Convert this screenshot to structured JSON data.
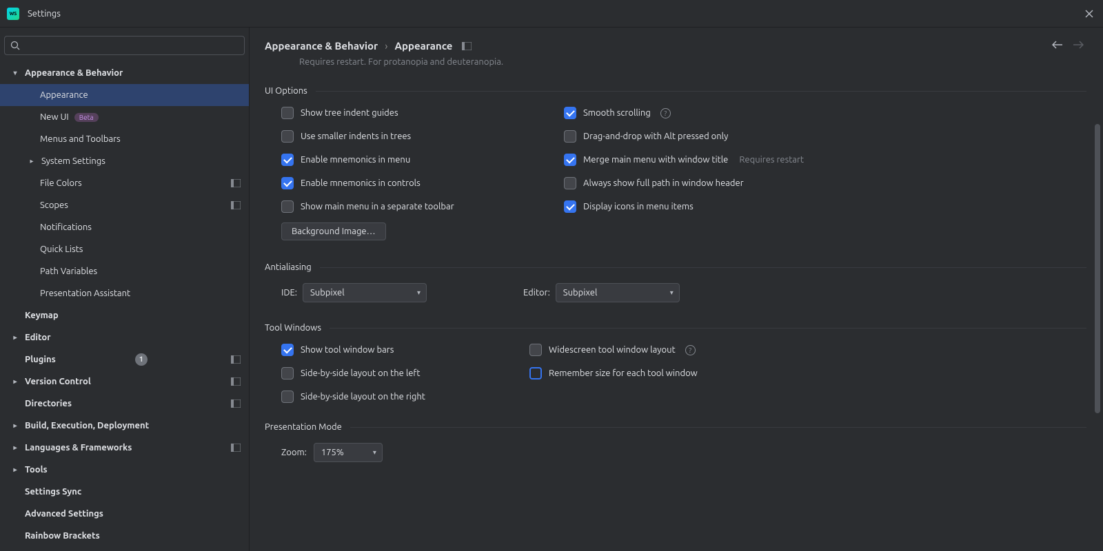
{
  "window": {
    "title": "Settings",
    "app_icon_text": "WS"
  },
  "search": {
    "placeholder": ""
  },
  "sidebar": {
    "items": [
      {
        "label": "Appearance & Behavior",
        "level": 1,
        "chevron": "down"
      },
      {
        "label": "Appearance",
        "level": 2,
        "selected": true
      },
      {
        "label": "New UI",
        "level": 2,
        "badge": "Beta"
      },
      {
        "label": "Menus and Toolbars",
        "level": 2
      },
      {
        "label": "System Settings",
        "level": 2,
        "chevron": "right",
        "chevron_indent": true
      },
      {
        "label": "File Colors",
        "level": 2,
        "project_icon": true
      },
      {
        "label": "Scopes",
        "level": 2,
        "project_icon": true
      },
      {
        "label": "Notifications",
        "level": 2
      },
      {
        "label": "Quick Lists",
        "level": 2
      },
      {
        "label": "Path Variables",
        "level": 2
      },
      {
        "label": "Presentation Assistant",
        "level": 2
      },
      {
        "label": "Keymap",
        "level": 1,
        "chevron": "none"
      },
      {
        "label": "Editor",
        "level": 1,
        "chevron": "right"
      },
      {
        "label": "Plugins",
        "level": 1,
        "chevron": "none",
        "count": "1",
        "project_icon": true
      },
      {
        "label": "Version Control",
        "level": 1,
        "chevron": "right",
        "project_icon": true
      },
      {
        "label": "Directories",
        "level": 1,
        "chevron": "none",
        "project_icon": true
      },
      {
        "label": "Build, Execution, Deployment",
        "level": 1,
        "chevron": "right"
      },
      {
        "label": "Languages & Frameworks",
        "level": 1,
        "chevron": "right",
        "project_icon": true
      },
      {
        "label": "Tools",
        "level": 1,
        "chevron": "right"
      },
      {
        "label": "Settings Sync",
        "level": 1,
        "chevron": "none"
      },
      {
        "label": "Advanced Settings",
        "level": 1,
        "chevron": "none"
      },
      {
        "label": "Rainbow Brackets",
        "level": 1,
        "chevron": "none"
      }
    ]
  },
  "breadcrumb": {
    "root": "Appearance & Behavior",
    "sep": "›",
    "leaf": "Appearance"
  },
  "hint": "Requires restart. For protanopia and deuteranopia.",
  "sections": {
    "ui_options": {
      "title": "UI Options",
      "left": [
        {
          "label": "Show tree indent guides",
          "checked": false
        },
        {
          "label": "Use smaller indents in trees",
          "checked": false
        },
        {
          "label": "Enable mnemonics in menu",
          "checked": true
        },
        {
          "label": "Enable mnemonics in controls",
          "checked": true
        },
        {
          "label": "Show main menu in a separate toolbar",
          "checked": false
        }
      ],
      "right": [
        {
          "label": "Smooth scrolling",
          "checked": true,
          "help": true
        },
        {
          "label": "Drag-and-drop with Alt pressed only",
          "checked": false
        },
        {
          "label": "Merge main menu with window title",
          "checked": true,
          "suffix": "Requires restart"
        },
        {
          "label": "Always show full path in window header",
          "checked": false
        },
        {
          "label": "Display icons in menu items",
          "checked": true
        }
      ],
      "button": "Background Image…"
    },
    "antialiasing": {
      "title": "Antialiasing",
      "ide_label": "IDE:",
      "ide_value": "Subpixel",
      "editor_label": "Editor:",
      "editor_value": "Subpixel"
    },
    "tool_windows": {
      "title": "Tool Windows",
      "left": [
        {
          "label": "Show tool window bars",
          "checked": true
        },
        {
          "label": "Side-by-side layout on the left",
          "checked": false
        },
        {
          "label": "Side-by-side layout on the right",
          "checked": false
        }
      ],
      "right": [
        {
          "label": "Widescreen tool window layout",
          "checked": false,
          "help": true
        },
        {
          "label": "Remember size for each tool window",
          "checked": false,
          "highlight": true
        }
      ]
    },
    "presentation": {
      "title": "Presentation Mode",
      "zoom_label": "Zoom:",
      "zoom_value": "175%"
    }
  }
}
